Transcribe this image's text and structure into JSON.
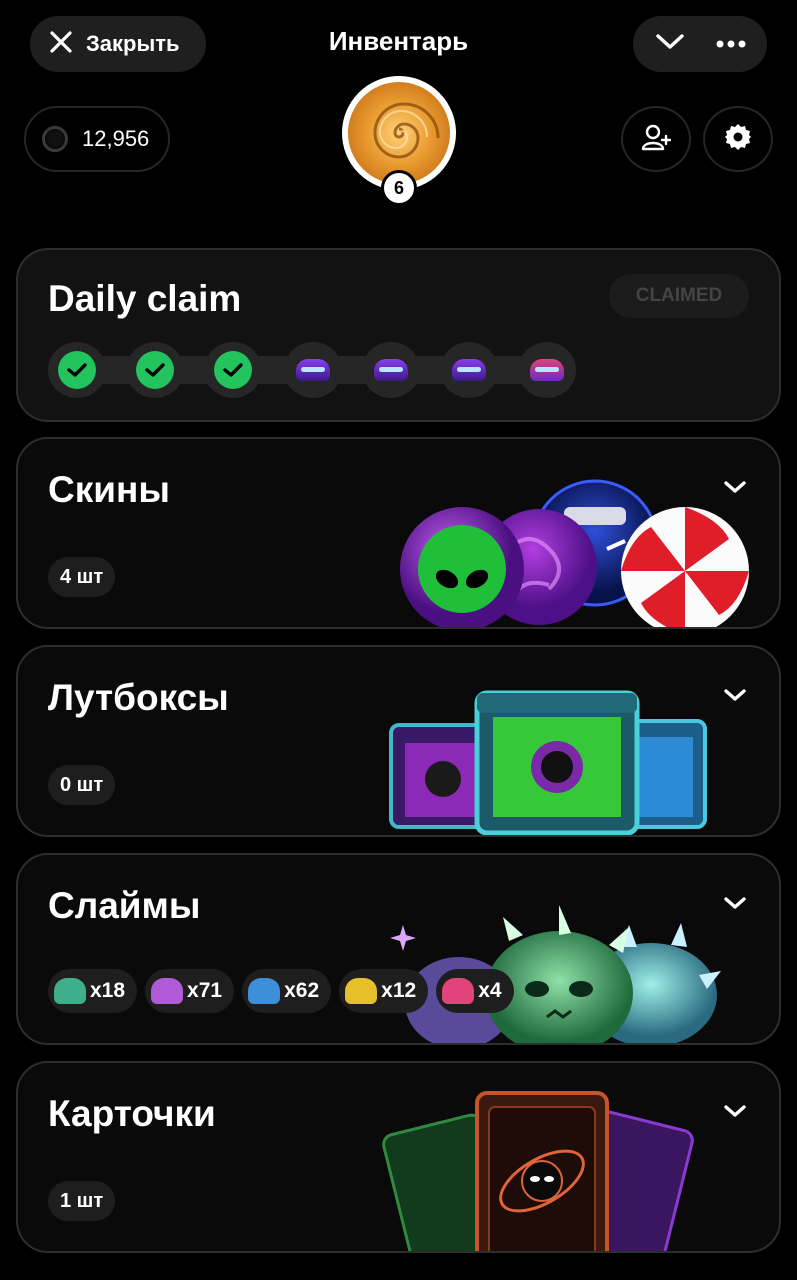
{
  "header": {
    "close_label": "Закрыть",
    "title": "Инвентарь"
  },
  "balance": {
    "value": "12,956"
  },
  "profile": {
    "level": "6"
  },
  "daily": {
    "title": "Daily claim",
    "status_label": "CLAIMED",
    "days": [
      {
        "state": "claimed"
      },
      {
        "state": "claimed"
      },
      {
        "state": "claimed"
      },
      {
        "state": "reward"
      },
      {
        "state": "reward"
      },
      {
        "state": "reward"
      },
      {
        "state": "reward"
      }
    ]
  },
  "sections": {
    "skins": {
      "title": "Скины",
      "count": "4 шт"
    },
    "lootboxes": {
      "title": "Лутбоксы",
      "count": "0 шт"
    },
    "slimes": {
      "title": "Слаймы",
      "chips": [
        {
          "label": "x18",
          "color": "#3fae8a"
        },
        {
          "label": "x71",
          "color": "#b05ad8"
        },
        {
          "label": "x62",
          "color": "#3c8fd8"
        },
        {
          "label": "x12",
          "color": "#e6c02a"
        },
        {
          "label": "x4",
          "color": "#e0447a"
        }
      ]
    },
    "cards": {
      "title": "Карточки",
      "count": "1 шт"
    }
  },
  "colors": {
    "accent_green": "#23c35e",
    "card_border": "#2e2e2e",
    "pill_bg": "#1e1e1e"
  }
}
